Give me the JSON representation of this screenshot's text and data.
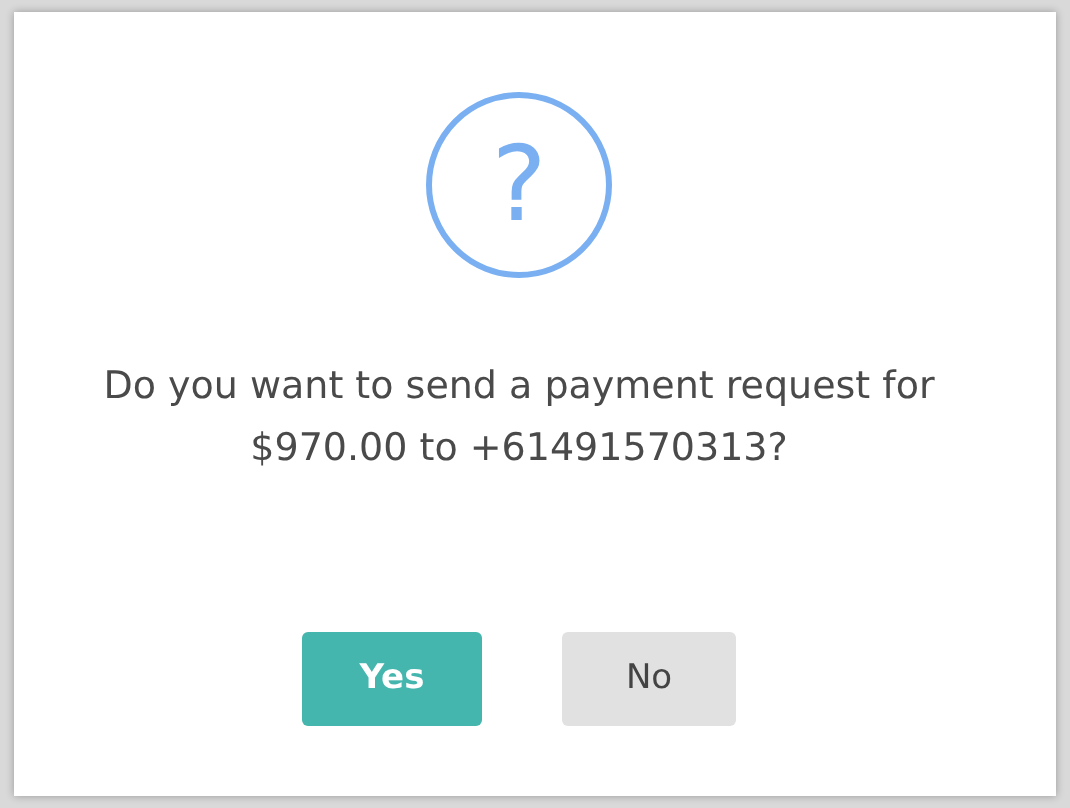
{
  "dialog": {
    "icon_glyph": "?",
    "message": "Do you want to send a payment request for $970.00 to +61491570313?",
    "buttons": [
      {
        "label": "Yes",
        "kind": "primary"
      },
      {
        "label": "No",
        "kind": "secondary"
      }
    ]
  }
}
